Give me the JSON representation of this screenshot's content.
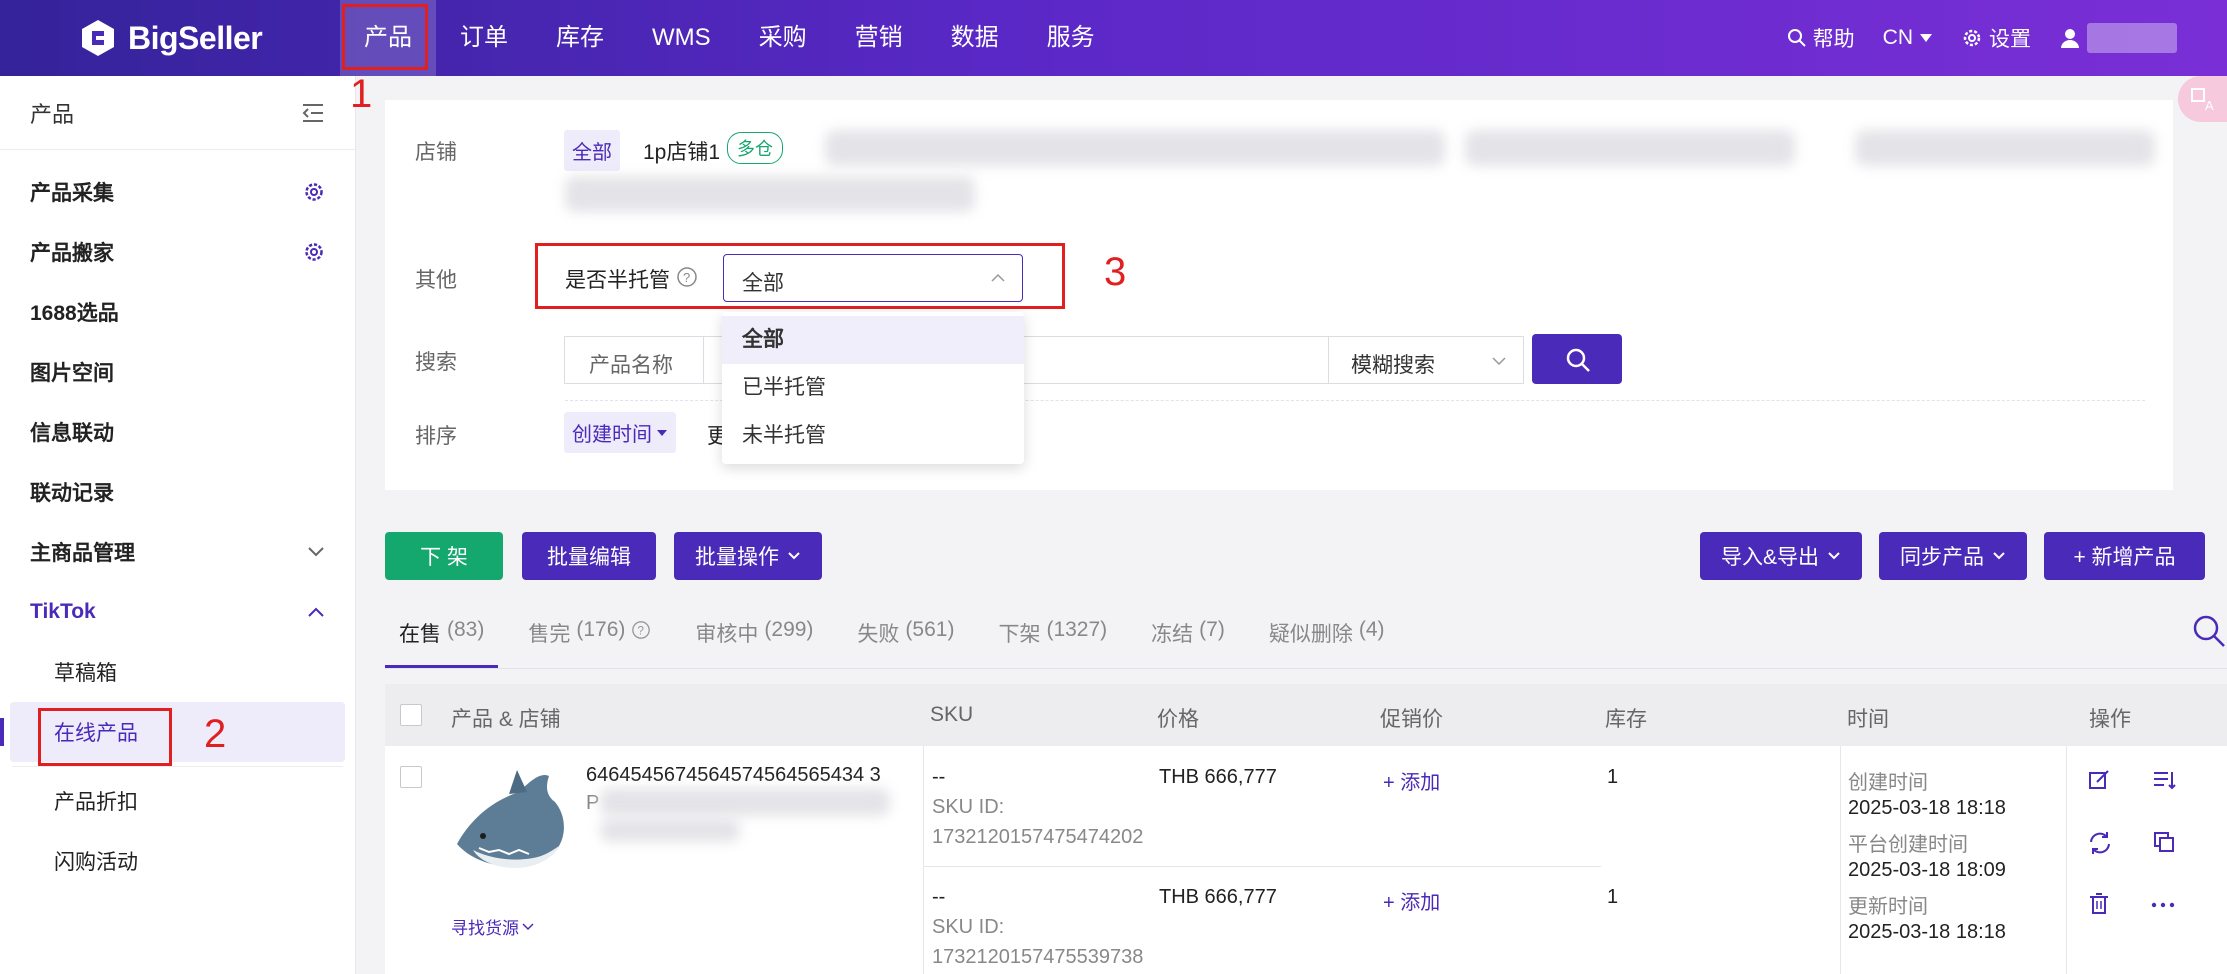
{
  "app": {
    "logo_text": "BigSeller"
  },
  "nav": {
    "items": [
      "产品",
      "订单",
      "库存",
      "WMS",
      "采购",
      "营销",
      "数据",
      "服务"
    ],
    "help": "帮助",
    "lang": "CN",
    "settings": "设置"
  },
  "annotations": [
    "1",
    "2",
    "3"
  ],
  "sidebar": {
    "title": "产品",
    "items": [
      "产品采集",
      "产品搬家",
      "1688选品",
      "图片空间",
      "信息联动",
      "联动记录",
      "主商品管理",
      "TikTok"
    ],
    "sub_items": [
      "草稿箱",
      "在线产品",
      "产品折扣",
      "闪购活动"
    ]
  },
  "filters": {
    "store_label": "店铺",
    "store_all": "全部",
    "store_first": "1p店铺1",
    "store_badge": "多仓",
    "other_label": "其他",
    "semi_label": "是否半托管",
    "semi_value": "全部",
    "search_label": "搜索",
    "search_field": "产品名称",
    "search_mode": "模糊搜索",
    "sort_label": "排序",
    "sort_value": "创建时间",
    "sort_more": "更",
    "dropdown_options": [
      "全部",
      "已半托管",
      "未半托管"
    ]
  },
  "actions": {
    "delist": "下 架",
    "bulk_edit": "批量编辑",
    "bulk_ops": "批量操作",
    "import_export": "导入&导出",
    "sync": "同步产品",
    "add": "+ 新增产品"
  },
  "tabs": [
    {
      "label": "在售",
      "count": "(83)"
    },
    {
      "label": "售完",
      "count": "(176)"
    },
    {
      "label": "审核中",
      "count": "(299)"
    },
    {
      "label": "失败",
      "count": "(561)"
    },
    {
      "label": "下架",
      "count": "(1327)"
    },
    {
      "label": "冻结",
      "count": "(7)"
    },
    {
      "label": "疑似删除",
      "count": "(4)"
    }
  ],
  "table": {
    "headers": [
      "产品 & 店铺",
      "SKU",
      "价格",
      "促销价",
      "库存",
      "时间",
      "操作"
    ],
    "product": {
      "id": "6464545674564574564565434 3",
      "name_prefix": "P",
      "find_source": "寻找货源"
    },
    "skus": [
      {
        "sku": "--",
        "sku_id_label": "SKU ID:",
        "sku_id": "1732120157475474202",
        "price": "THB 666,777",
        "promo": "+ 添加",
        "stock": "1"
      },
      {
        "sku": "--",
        "sku_id_label": "SKU ID:",
        "sku_id": "1732120157475539738",
        "price": "THB 666,777",
        "promo": "+ 添加",
        "stock": "1"
      }
    ],
    "times": {
      "created_label": "创建时间",
      "created": "2025-03-18 18:18",
      "platform_label": "平台创建时间",
      "platform": "2025-03-18 18:09",
      "updated_label": "更新时间",
      "updated": "2025-03-18 18:18"
    }
  },
  "colors": {
    "primary": "#4a2ab8",
    "green": "#14a76e",
    "annotation": "#e02020"
  }
}
